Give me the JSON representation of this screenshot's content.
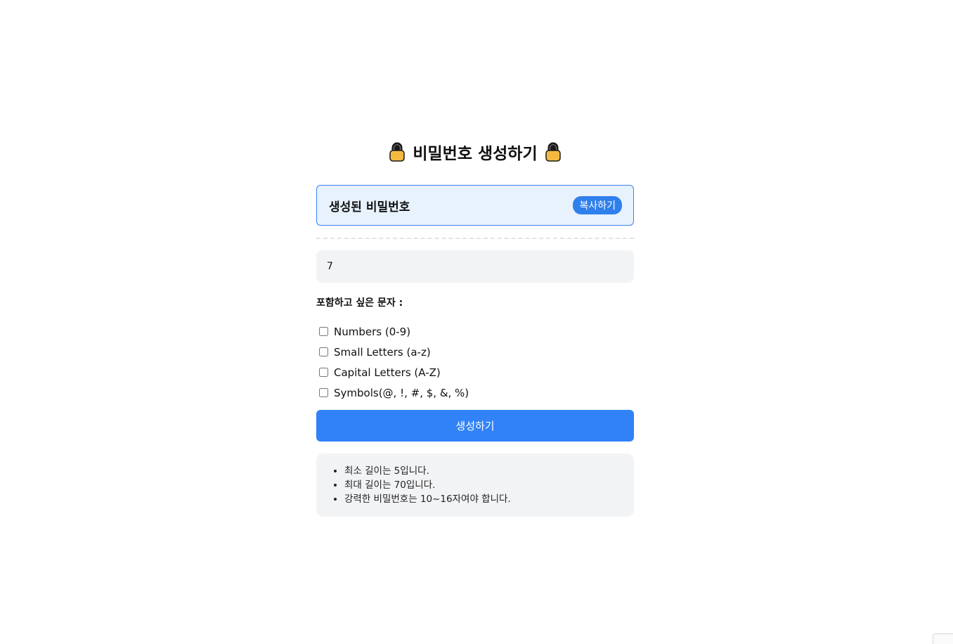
{
  "header": {
    "title": "비밀번호 생성하기",
    "left_icon": "lock-icon",
    "right_icon": "lock-icon"
  },
  "result": {
    "label": "생성된 비밀번호",
    "copy_label": "복사하기"
  },
  "length_input": {
    "value": "7"
  },
  "options": {
    "heading": "포함하고 싶은 문자 :",
    "items": [
      {
        "label": "Numbers (0-9)",
        "checked": false
      },
      {
        "label": "Small Letters (a-z)",
        "checked": false
      },
      {
        "label": "Capital Letters (A-Z)",
        "checked": false
      },
      {
        "label": "Symbols(@, !, #, $, &, %)",
        "checked": false
      }
    ]
  },
  "generate_label": "생성하기",
  "info": {
    "items": [
      "최소 길이는 5입니다.",
      "최대 길이는 70입니다.",
      "강력한 비밀번호는 10~16자여야 합니다."
    ]
  },
  "colors": {
    "accent": "#3182f6",
    "result_bg": "#e8f2fc",
    "panel_bg": "#f2f3f5",
    "lock_body": "#f5b942"
  }
}
